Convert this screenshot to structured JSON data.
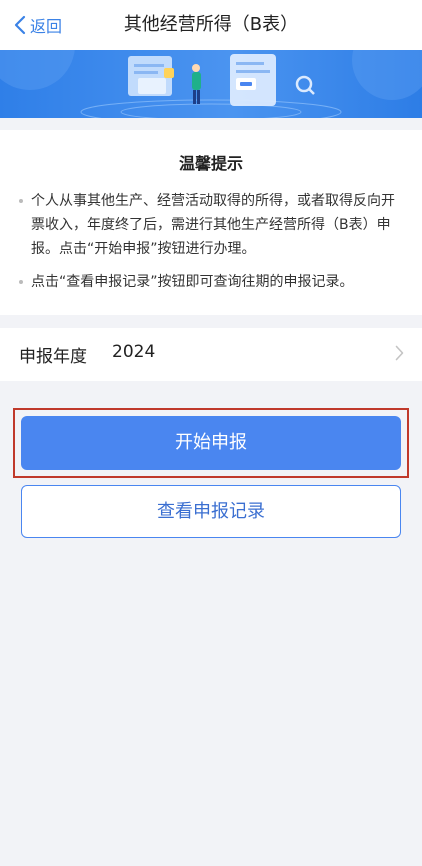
{
  "header": {
    "back_label": "返回",
    "title": "其他经营所得（B表）"
  },
  "colors": {
    "accent": "#4a86f0",
    "banner": "#2f7fe8",
    "highlight_border": "#c0392b",
    "page_bg": "#f2f3f7"
  },
  "tips": {
    "title": "温馨提示",
    "items": [
      "个人从事其他生产、经营活动取得的所得，或者取得反向开票收入，年度终了后，需进行其他生产经营所得（B表）申报。点击“开始申报”按钮进行办理。",
      "点击“查看申报记录”按钮即可查询往期的申报记录。"
    ]
  },
  "year_row": {
    "label": "申报年度",
    "value": "2024"
  },
  "actions": {
    "start_label": "开始申报",
    "history_label": "查看申报记录"
  }
}
